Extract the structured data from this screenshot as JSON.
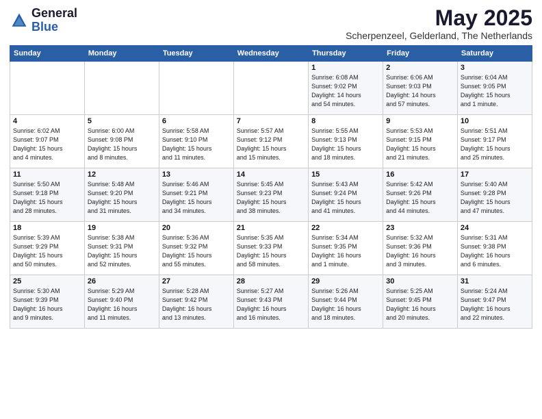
{
  "header": {
    "logo_general": "General",
    "logo_blue": "Blue",
    "month_title": "May 2025",
    "subtitle": "Scherpenzeel, Gelderland, The Netherlands"
  },
  "days_of_week": [
    "Sunday",
    "Monday",
    "Tuesday",
    "Wednesday",
    "Thursday",
    "Friday",
    "Saturday"
  ],
  "weeks": [
    [
      {
        "day": "",
        "info": ""
      },
      {
        "day": "",
        "info": ""
      },
      {
        "day": "",
        "info": ""
      },
      {
        "day": "",
        "info": ""
      },
      {
        "day": "1",
        "info": "Sunrise: 6:08 AM\nSunset: 9:02 PM\nDaylight: 14 hours\nand 54 minutes."
      },
      {
        "day": "2",
        "info": "Sunrise: 6:06 AM\nSunset: 9:03 PM\nDaylight: 14 hours\nand 57 minutes."
      },
      {
        "day": "3",
        "info": "Sunrise: 6:04 AM\nSunset: 9:05 PM\nDaylight: 15 hours\nand 1 minute."
      }
    ],
    [
      {
        "day": "4",
        "info": "Sunrise: 6:02 AM\nSunset: 9:07 PM\nDaylight: 15 hours\nand 4 minutes."
      },
      {
        "day": "5",
        "info": "Sunrise: 6:00 AM\nSunset: 9:08 PM\nDaylight: 15 hours\nand 8 minutes."
      },
      {
        "day": "6",
        "info": "Sunrise: 5:58 AM\nSunset: 9:10 PM\nDaylight: 15 hours\nand 11 minutes."
      },
      {
        "day": "7",
        "info": "Sunrise: 5:57 AM\nSunset: 9:12 PM\nDaylight: 15 hours\nand 15 minutes."
      },
      {
        "day": "8",
        "info": "Sunrise: 5:55 AM\nSunset: 9:13 PM\nDaylight: 15 hours\nand 18 minutes."
      },
      {
        "day": "9",
        "info": "Sunrise: 5:53 AM\nSunset: 9:15 PM\nDaylight: 15 hours\nand 21 minutes."
      },
      {
        "day": "10",
        "info": "Sunrise: 5:51 AM\nSunset: 9:17 PM\nDaylight: 15 hours\nand 25 minutes."
      }
    ],
    [
      {
        "day": "11",
        "info": "Sunrise: 5:50 AM\nSunset: 9:18 PM\nDaylight: 15 hours\nand 28 minutes."
      },
      {
        "day": "12",
        "info": "Sunrise: 5:48 AM\nSunset: 9:20 PM\nDaylight: 15 hours\nand 31 minutes."
      },
      {
        "day": "13",
        "info": "Sunrise: 5:46 AM\nSunset: 9:21 PM\nDaylight: 15 hours\nand 34 minutes."
      },
      {
        "day": "14",
        "info": "Sunrise: 5:45 AM\nSunset: 9:23 PM\nDaylight: 15 hours\nand 38 minutes."
      },
      {
        "day": "15",
        "info": "Sunrise: 5:43 AM\nSunset: 9:24 PM\nDaylight: 15 hours\nand 41 minutes."
      },
      {
        "day": "16",
        "info": "Sunrise: 5:42 AM\nSunset: 9:26 PM\nDaylight: 15 hours\nand 44 minutes."
      },
      {
        "day": "17",
        "info": "Sunrise: 5:40 AM\nSunset: 9:28 PM\nDaylight: 15 hours\nand 47 minutes."
      }
    ],
    [
      {
        "day": "18",
        "info": "Sunrise: 5:39 AM\nSunset: 9:29 PM\nDaylight: 15 hours\nand 50 minutes."
      },
      {
        "day": "19",
        "info": "Sunrise: 5:38 AM\nSunset: 9:31 PM\nDaylight: 15 hours\nand 52 minutes."
      },
      {
        "day": "20",
        "info": "Sunrise: 5:36 AM\nSunset: 9:32 PM\nDaylight: 15 hours\nand 55 minutes."
      },
      {
        "day": "21",
        "info": "Sunrise: 5:35 AM\nSunset: 9:33 PM\nDaylight: 15 hours\nand 58 minutes."
      },
      {
        "day": "22",
        "info": "Sunrise: 5:34 AM\nSunset: 9:35 PM\nDaylight: 16 hours\nand 1 minute."
      },
      {
        "day": "23",
        "info": "Sunrise: 5:32 AM\nSunset: 9:36 PM\nDaylight: 16 hours\nand 3 minutes."
      },
      {
        "day": "24",
        "info": "Sunrise: 5:31 AM\nSunset: 9:38 PM\nDaylight: 16 hours\nand 6 minutes."
      }
    ],
    [
      {
        "day": "25",
        "info": "Sunrise: 5:30 AM\nSunset: 9:39 PM\nDaylight: 16 hours\nand 9 minutes."
      },
      {
        "day": "26",
        "info": "Sunrise: 5:29 AM\nSunset: 9:40 PM\nDaylight: 16 hours\nand 11 minutes."
      },
      {
        "day": "27",
        "info": "Sunrise: 5:28 AM\nSunset: 9:42 PM\nDaylight: 16 hours\nand 13 minutes."
      },
      {
        "day": "28",
        "info": "Sunrise: 5:27 AM\nSunset: 9:43 PM\nDaylight: 16 hours\nand 16 minutes."
      },
      {
        "day": "29",
        "info": "Sunrise: 5:26 AM\nSunset: 9:44 PM\nDaylight: 16 hours\nand 18 minutes."
      },
      {
        "day": "30",
        "info": "Sunrise: 5:25 AM\nSunset: 9:45 PM\nDaylight: 16 hours\nand 20 minutes."
      },
      {
        "day": "31",
        "info": "Sunrise: 5:24 AM\nSunset: 9:47 PM\nDaylight: 16 hours\nand 22 minutes."
      }
    ]
  ]
}
